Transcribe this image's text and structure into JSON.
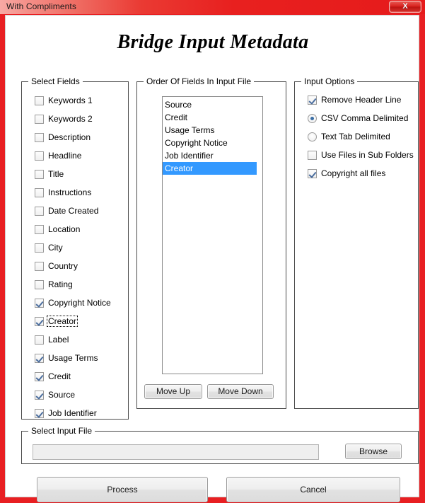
{
  "window": {
    "title": "With Compliments",
    "close_label": "X",
    "frame_color": "#e81f22",
    "titlebar_gradient_from": "#f7a9a4",
    "titlebar_gradient_to": "#e61b1b"
  },
  "heading": {
    "title": "Bridge Input Metadata"
  },
  "select_fields": {
    "legend": "Select Fields",
    "items": [
      {
        "label": "Keywords 1",
        "checked": false,
        "focused": false
      },
      {
        "label": "Keywords 2",
        "checked": false,
        "focused": false
      },
      {
        "label": "Description",
        "checked": false,
        "focused": false
      },
      {
        "label": "Headline",
        "checked": false,
        "focused": false
      },
      {
        "label": "Title",
        "checked": false,
        "focused": false
      },
      {
        "label": "Instructions",
        "checked": false,
        "focused": false
      },
      {
        "label": "Date Created",
        "checked": false,
        "focused": false
      },
      {
        "label": "Location",
        "checked": false,
        "focused": false
      },
      {
        "label": "City",
        "checked": false,
        "focused": false
      },
      {
        "label": "Country",
        "checked": false,
        "focused": false
      },
      {
        "label": "Rating",
        "checked": false,
        "focused": false
      },
      {
        "label": "Copyright Notice",
        "checked": true,
        "focused": false
      },
      {
        "label": "Creator",
        "checked": true,
        "focused": true
      },
      {
        "label": "Label",
        "checked": false,
        "focused": false
      },
      {
        "label": "Usage Terms",
        "checked": true,
        "focused": false
      },
      {
        "label": "Credit",
        "checked": true,
        "focused": false
      },
      {
        "label": "Source",
        "checked": true,
        "focused": false
      },
      {
        "label": "Job Identifier",
        "checked": true,
        "focused": false
      }
    ]
  },
  "order_of_fields": {
    "legend": "Order Of Fields In Input File",
    "items": [
      {
        "label": "Source",
        "selected": false
      },
      {
        "label": "Credit",
        "selected": false
      },
      {
        "label": "Usage Terms",
        "selected": false
      },
      {
        "label": "Copyright Notice",
        "selected": false
      },
      {
        "label": "Job Identifier",
        "selected": false
      },
      {
        "label": "Creator",
        "selected": true
      }
    ],
    "selection_color": "#3399ff",
    "move_up_label": "Move Up",
    "move_down_label": "Move Down"
  },
  "input_options": {
    "legend": "Input Options",
    "checkboxes": [
      {
        "label": "Remove Header Line",
        "checked": true
      },
      {
        "label": "Use Files in Sub Folders",
        "checked": false
      },
      {
        "label": "Copyright all files",
        "checked": true
      }
    ],
    "radios": [
      {
        "label": "CSV Comma Delimited",
        "selected": true
      },
      {
        "label": "Text Tab Delimited",
        "selected": false
      }
    ]
  },
  "input_file": {
    "legend": "Select Input File",
    "value": "",
    "placeholder": "",
    "browse_label": "Browse"
  },
  "actions": {
    "process_label": "Process",
    "cancel_label": "Cancel"
  }
}
